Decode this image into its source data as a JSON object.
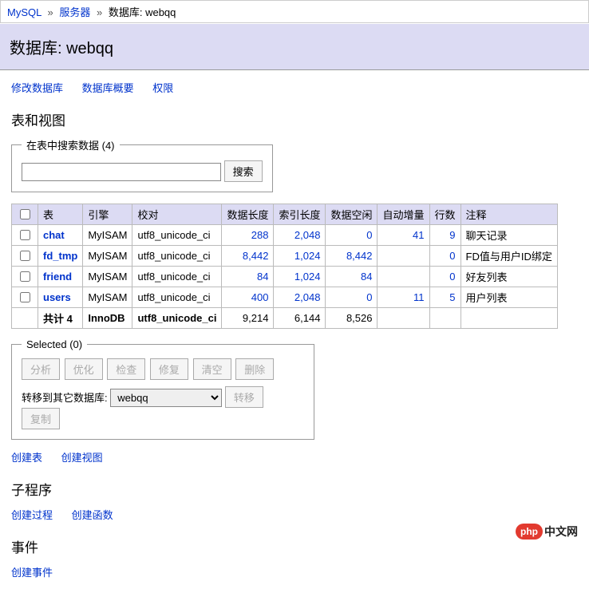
{
  "breadcrumb": {
    "mysql": "MySQL",
    "server": "服务器",
    "db_prefix": "数据库: ",
    "db_name": "webqq"
  },
  "header": {
    "title": "数据库: webqq"
  },
  "top_links": {
    "alter": "修改数据库",
    "schema": "数据库概要",
    "privileges": "权限"
  },
  "sections": {
    "tables_views": "表和视图",
    "routines": "子程序",
    "events": "事件"
  },
  "search": {
    "legend": "在表中搜索数据 (4)",
    "value": "",
    "button": "搜索"
  },
  "columns": {
    "checkbox": "",
    "table": "表",
    "engine": "引擎",
    "collation": "校对",
    "data_length": "数据长度",
    "index_length": "索引长度",
    "data_free": "数据空闲",
    "auto_increment": "自动增量",
    "rows": "行数",
    "comment": "注释"
  },
  "rows": [
    {
      "name": "chat",
      "engine": "MyISAM",
      "collation": "utf8_unicode_ci",
      "data_length": "288",
      "index_length": "2,048",
      "data_free": "0",
      "auto_increment": "41",
      "rows": "9",
      "comment": "聊天记录"
    },
    {
      "name": "fd_tmp",
      "engine": "MyISAM",
      "collation": "utf8_unicode_ci",
      "data_length": "8,442",
      "index_length": "1,024",
      "data_free": "8,442",
      "auto_increment": "",
      "rows": "0",
      "comment": "FD值与用户ID绑定"
    },
    {
      "name": "friend",
      "engine": "MyISAM",
      "collation": "utf8_unicode_ci",
      "data_length": "84",
      "index_length": "1,024",
      "data_free": "84",
      "auto_increment": "",
      "rows": "0",
      "comment": "好友列表"
    },
    {
      "name": "users",
      "engine": "MyISAM",
      "collation": "utf8_unicode_ci",
      "data_length": "400",
      "index_length": "2,048",
      "data_free": "0",
      "auto_increment": "11",
      "rows": "5",
      "comment": "用户列表"
    }
  ],
  "totals": {
    "label": "共计 4",
    "engine": "InnoDB",
    "collation": "utf8_unicode_ci",
    "data_length": "9,214",
    "index_length": "6,144",
    "data_free": "8,526"
  },
  "selected": {
    "legend": "Selected (0)",
    "analyze": "分析",
    "optimize": "优化",
    "check": "检查",
    "repair": "修复",
    "truncate": "清空",
    "drop": "删除",
    "move_label": "转移到其它数据库:",
    "move_target": "webqq",
    "move_btn": "转移",
    "copy_btn": "复制"
  },
  "bottom_links": {
    "create_table": "创建表",
    "create_view": "创建视图",
    "create_procedure": "创建过程",
    "create_function": "创建函数",
    "create_event": "创建事件"
  },
  "brand": {
    "badge": "php",
    "text": "中文网"
  }
}
